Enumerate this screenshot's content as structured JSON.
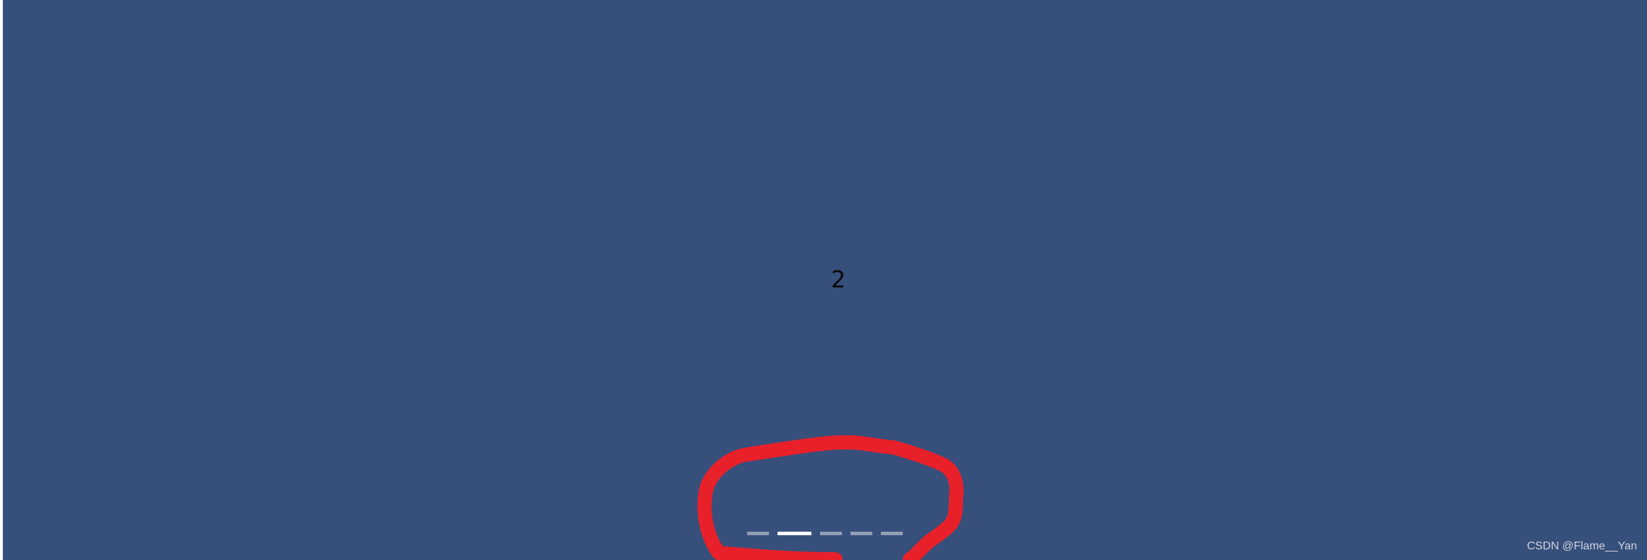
{
  "carousel": {
    "current_slide": "2",
    "active_index": 1,
    "indicator_count": 5,
    "background_color": "#374f7b",
    "indicator_color": "#ffffff"
  },
  "annotation": {
    "shape": "hand-drawn red circle",
    "color": "#e8202a"
  },
  "watermark": {
    "text": "CSDN @Flame__Yan"
  }
}
